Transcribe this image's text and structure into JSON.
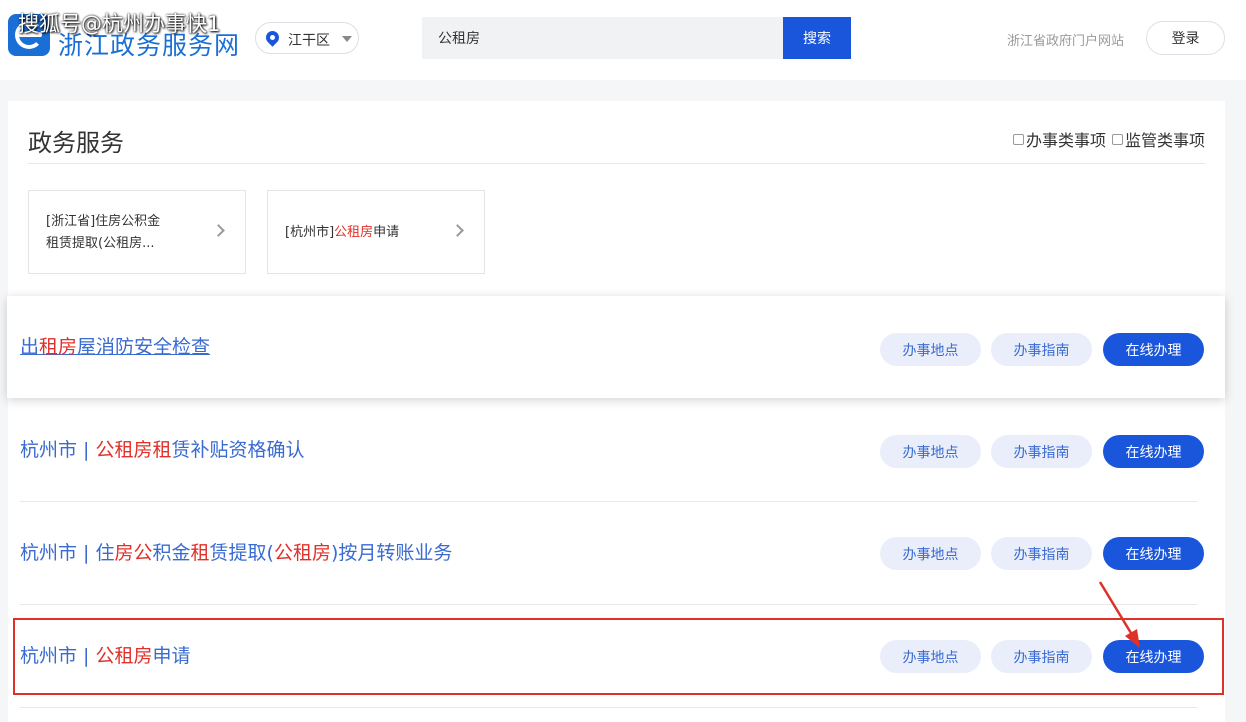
{
  "watermark": "搜狐号@杭州办事快1",
  "header": {
    "site_name": "浙江政务服务网",
    "region": "江干区",
    "search_value": "公租房",
    "search_button": "搜索",
    "portal_link": "浙江省政府门户网站",
    "login_button": "登录"
  },
  "panel": {
    "title": "政务服务",
    "filters": [
      "办事类事项",
      "监管类事项"
    ]
  },
  "cards": [
    {
      "line1": "[浙江省]住房公积金",
      "line2": "租赁提取(公租房..."
    },
    {
      "prefix": "[杭州市]",
      "highlight": "公租房",
      "suffix": "申请"
    }
  ],
  "rows": [
    {
      "segments": [
        {
          "t": "出",
          "h": false
        },
        {
          "t": "租房",
          "h": true
        },
        {
          "t": "屋消防安全检查",
          "h": false
        }
      ]
    },
    {
      "segments": [
        {
          "t": "杭州市 | ",
          "h": false
        },
        {
          "t": "公租房租",
          "h": true
        },
        {
          "t": "赁补贴资格确认",
          "h": false
        }
      ]
    },
    {
      "segments": [
        {
          "t": "杭州市 | 住",
          "h": false
        },
        {
          "t": "房公",
          "h": true
        },
        {
          "t": "积金",
          "h": false
        },
        {
          "t": "租",
          "h": true
        },
        {
          "t": "赁提取(",
          "h": false
        },
        {
          "t": "公租房",
          "h": true
        },
        {
          "t": ")按月转账业务",
          "h": false
        }
      ]
    },
    {
      "segments": [
        {
          "t": "杭州市 | ",
          "h": false
        },
        {
          "t": "公租房",
          "h": true
        },
        {
          "t": "申请",
          "h": false
        }
      ]
    }
  ],
  "buttons": {
    "location": "办事地点",
    "guide": "办事指南",
    "online": "在线办理"
  },
  "colors": {
    "brand": "#1a56db",
    "link": "#3a6bd1",
    "highlight": "#e0302a"
  }
}
